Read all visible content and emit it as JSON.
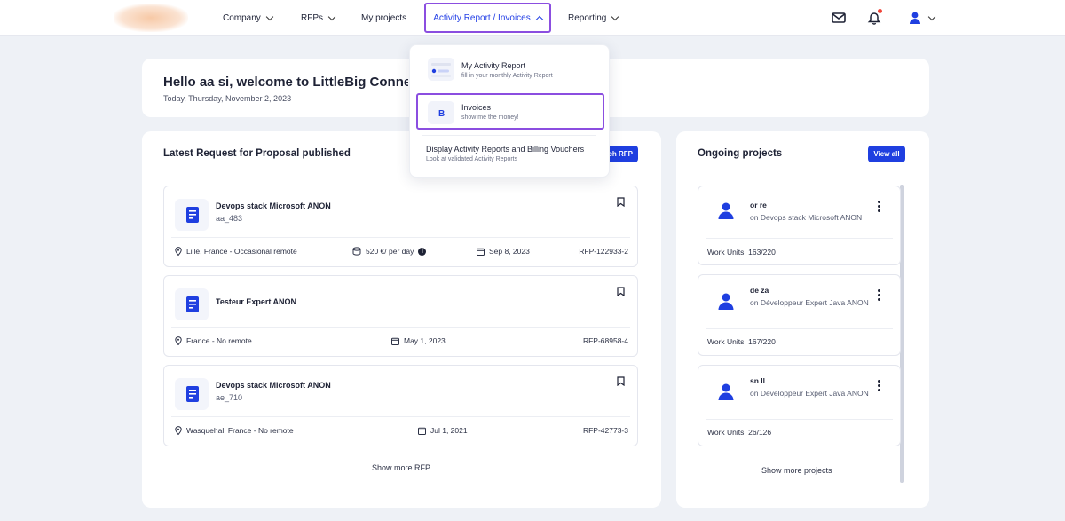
{
  "nav": {
    "items": [
      {
        "label": "Company",
        "has_chevron": true
      },
      {
        "label": "RFPs",
        "has_chevron": true
      },
      {
        "label": "My projects",
        "has_chevron": false
      },
      {
        "label": "Activity Report / Invoices",
        "has_chevron": true,
        "active": true
      },
      {
        "label": "Reporting",
        "has_chevron": true
      }
    ],
    "icons": [
      "mail-icon",
      "bell-icon",
      "user-icon",
      "chevron-down-icon"
    ],
    "accent_color": "#1f3fe0",
    "highlight_color": "#8b4ee0"
  },
  "dropdown": {
    "items": [
      {
        "title": "My Activity Report",
        "subtitle": "fill in your monthly Activity Report",
        "icon": "activity-report-icon"
      },
      {
        "title": "Invoices",
        "subtitle": "show me the money!",
        "icon": "bitcoin-icon",
        "highlighted": true
      },
      {
        "title": "Display Activity Reports and Billing Vouchers",
        "subtitle": "Look at validated Activity Reports"
      }
    ]
  },
  "welcome": {
    "title": "Hello aa si, welcome to LittleBig Connection",
    "date": "Today, Thursday, November 2, 2023"
  },
  "rfp_section": {
    "title": "Latest Request for Proposal published",
    "search_button": "Search RFP",
    "show_more": "Show more RFP",
    "items": [
      {
        "title": "Devops stack Microsoft ANON",
        "subtitle": "aa_483",
        "location": "Lille, France - Occasional remote",
        "rate": "520 €/ per day",
        "date": "Sep 8, 2023",
        "ref": "RFP-122933-2"
      },
      {
        "title": "Testeur Expert ANON",
        "subtitle": "",
        "location": "France - No remote",
        "rate": "",
        "date": "May 1, 2023",
        "ref": "RFP-68958-4"
      },
      {
        "title": "Devops stack Microsoft ANON",
        "subtitle": "ae_710",
        "location": "Wasquehal, France - No remote",
        "rate": "",
        "date": "Jul 1, 2021",
        "ref": "RFP-42773-3"
      }
    ]
  },
  "projects_section": {
    "title": "Ongoing projects",
    "view_all": "View all",
    "show_more": "Show more projects",
    "items": [
      {
        "name": "or re",
        "on": "on Devops stack Microsoft ANON",
        "work_units": "Work Units: 163/220"
      },
      {
        "name": "de za",
        "on": "on Développeur Expert Java ANON",
        "work_units": "Work Units: 167/220"
      },
      {
        "name": "sn ll",
        "on": "on Développeur Expert Java ANON",
        "work_units": "Work Units: 26/126"
      }
    ]
  }
}
